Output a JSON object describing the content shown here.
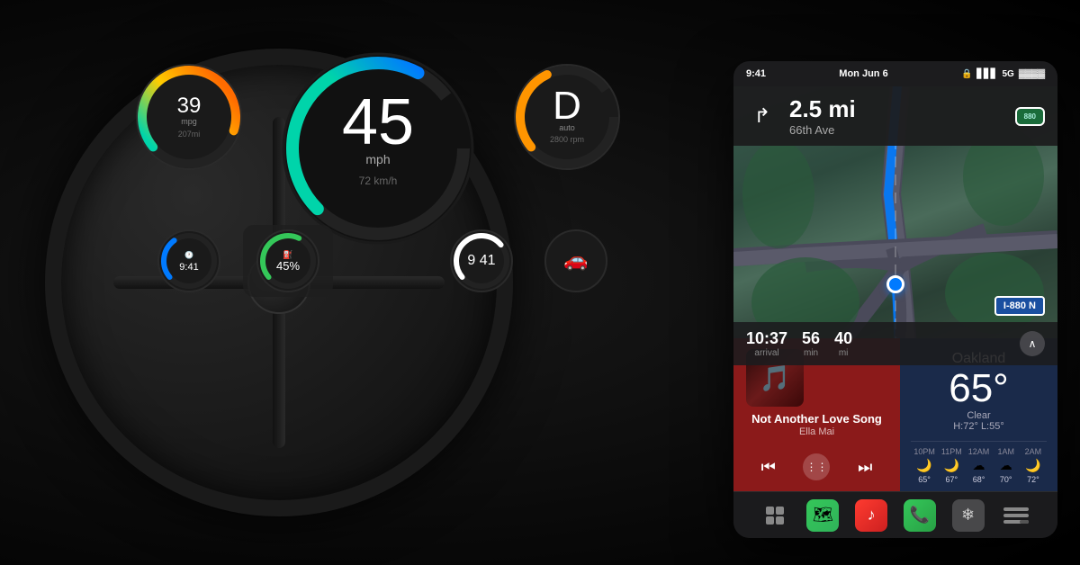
{
  "car": {
    "speed": "45",
    "speed_unit": "mph",
    "speed_kmh": "72 km/h",
    "mpg": "39",
    "mpg_unit": "mpg",
    "mpg_sub": "207mi",
    "gear": "D",
    "gear_mode": "auto",
    "rpm": "2800 rpm",
    "fuel_percent": "45%",
    "clock_time": "9 41"
  },
  "carplay": {
    "status_time": "9:41",
    "status_date": "Mon Jun 6",
    "signal_label": "5G",
    "nav": {
      "distance": "2.5 mi",
      "street": "66th Ave",
      "turn_direction": "→",
      "freeway": "880",
      "eta_time": "10:37",
      "eta_time_label": "arrival",
      "eta_min": "56",
      "eta_min_label": "min",
      "eta_mi": "40",
      "eta_mi_label": "mi",
      "interstate": "I-880 N"
    },
    "music": {
      "title": "Not Another Love Song",
      "artist": "Ella Mai",
      "prev_label": "⏮",
      "grid_label": "⋮⋮⋮",
      "next_label": "⏭"
    },
    "weather": {
      "city": "Oakland",
      "temp": "65°",
      "condition": "Clear",
      "high": "H:72°",
      "low": "L:55°",
      "hourly": [
        {
          "time": "10PM",
          "icon": "🌙",
          "temp": "65°"
        },
        {
          "time": "11PM",
          "icon": "🌙",
          "temp": "67°"
        },
        {
          "time": "12AM",
          "icon": "☁",
          "temp": "68°"
        },
        {
          "time": "1AM",
          "icon": "☁",
          "temp": "70°"
        },
        {
          "time": "2AM",
          "icon": "🌙",
          "temp": "72°"
        }
      ]
    },
    "dock": [
      {
        "name": "home",
        "label": "⊞",
        "type": "home"
      },
      {
        "name": "maps",
        "label": "🗺",
        "type": "maps"
      },
      {
        "name": "music",
        "label": "♪",
        "type": "music"
      },
      {
        "name": "phone",
        "label": "📞",
        "type": "phone"
      },
      {
        "name": "fan",
        "label": "✦",
        "type": "fan"
      },
      {
        "name": "more",
        "label": "⋯",
        "type": "more"
      }
    ]
  }
}
